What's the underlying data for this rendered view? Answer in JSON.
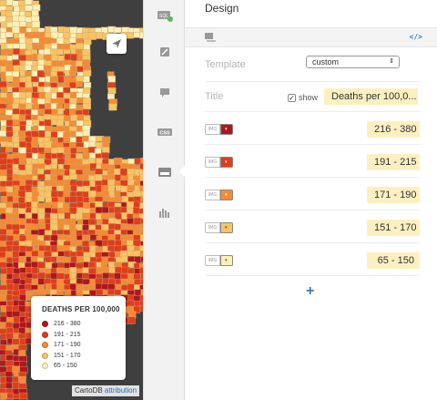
{
  "map": {
    "share_icon": "paper-plane-icon",
    "legend": {
      "title": "DEATHS PER 100,000",
      "items": [
        {
          "label": "216 - 380",
          "color": "#b0171c"
        },
        {
          "label": "191 - 215",
          "color": "#e03d1b"
        },
        {
          "label": "171 - 190",
          "color": "#f48b34"
        },
        {
          "label": "151 - 170",
          "color": "#f9c462"
        },
        {
          "label": "65 - 150",
          "color": "#fdf0b5"
        }
      ]
    },
    "attribution": {
      "prefix": "CartoDB",
      "link": "attribution"
    },
    "colors": {
      "water": "#3f3f3f"
    }
  },
  "toolbar": {
    "items": [
      {
        "name": "sql",
        "icon": "sql-icon",
        "label": "SQL"
      },
      {
        "name": "wizard",
        "icon": "brush-icon"
      },
      {
        "name": "infowindow",
        "icon": "speech-bubble-icon"
      },
      {
        "name": "css",
        "icon": "css-icon",
        "label": "CSS"
      },
      {
        "name": "legend",
        "icon": "legend-icon"
      },
      {
        "name": "filters",
        "icon": "bar-chart-icon"
      }
    ]
  },
  "panel": {
    "title": "Design",
    "code_label": "</>",
    "template_label": "Template",
    "template_value": "custom",
    "title_label": "Title",
    "show_label": "show",
    "title_value": "Deaths per 100,0...",
    "img_label": "IMG",
    "items": [
      {
        "label": "216 - 380",
        "color": "#b0171c"
      },
      {
        "label": "191 - 215",
        "color": "#e03d1b"
      },
      {
        "label": "171 - 190",
        "color": "#f48b34"
      },
      {
        "label": "151 - 170",
        "color": "#f9c462"
      },
      {
        "label": "65 - 150",
        "color": "#fdf0b5"
      }
    ],
    "add_label": "+",
    "accent": "#3a7ab8"
  }
}
